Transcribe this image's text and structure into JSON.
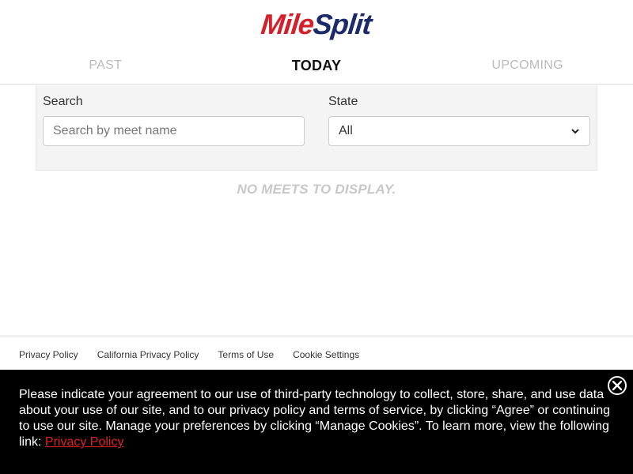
{
  "logo": {
    "part1": "Mile",
    "part2": "Split"
  },
  "tabs": [
    {
      "label": "PAST",
      "active": false
    },
    {
      "label": "TODAY",
      "active": true
    },
    {
      "label": "UPCOMING",
      "active": false
    }
  ],
  "filters": {
    "search": {
      "label": "Search",
      "placeholder": "Search by meet name",
      "value": ""
    },
    "state": {
      "label": "State",
      "value": "All"
    }
  },
  "empty_message": "NO MEETS TO DISPLAY.",
  "footer": {
    "links": [
      "Privacy Policy",
      "California Privacy Policy",
      "Terms of Use",
      "Cookie Settings"
    ]
  },
  "cookie_banner": {
    "text": "Please indicate your agreement to our use of third-party technology to collect, store, share, and use data about your use of our site, and to our privacy policy and terms of service, by clicking “Agree” or continuing to use our site. Manage your preferences by clicking “Manage Cookies”. To learn more, view the following link: ",
    "link_label": "Privacy Policy",
    "close_icon": "close-icon"
  },
  "colors": {
    "brand_red": "#d3202a",
    "brand_navy": "#1d2a6b",
    "link_red": "#e02020"
  }
}
